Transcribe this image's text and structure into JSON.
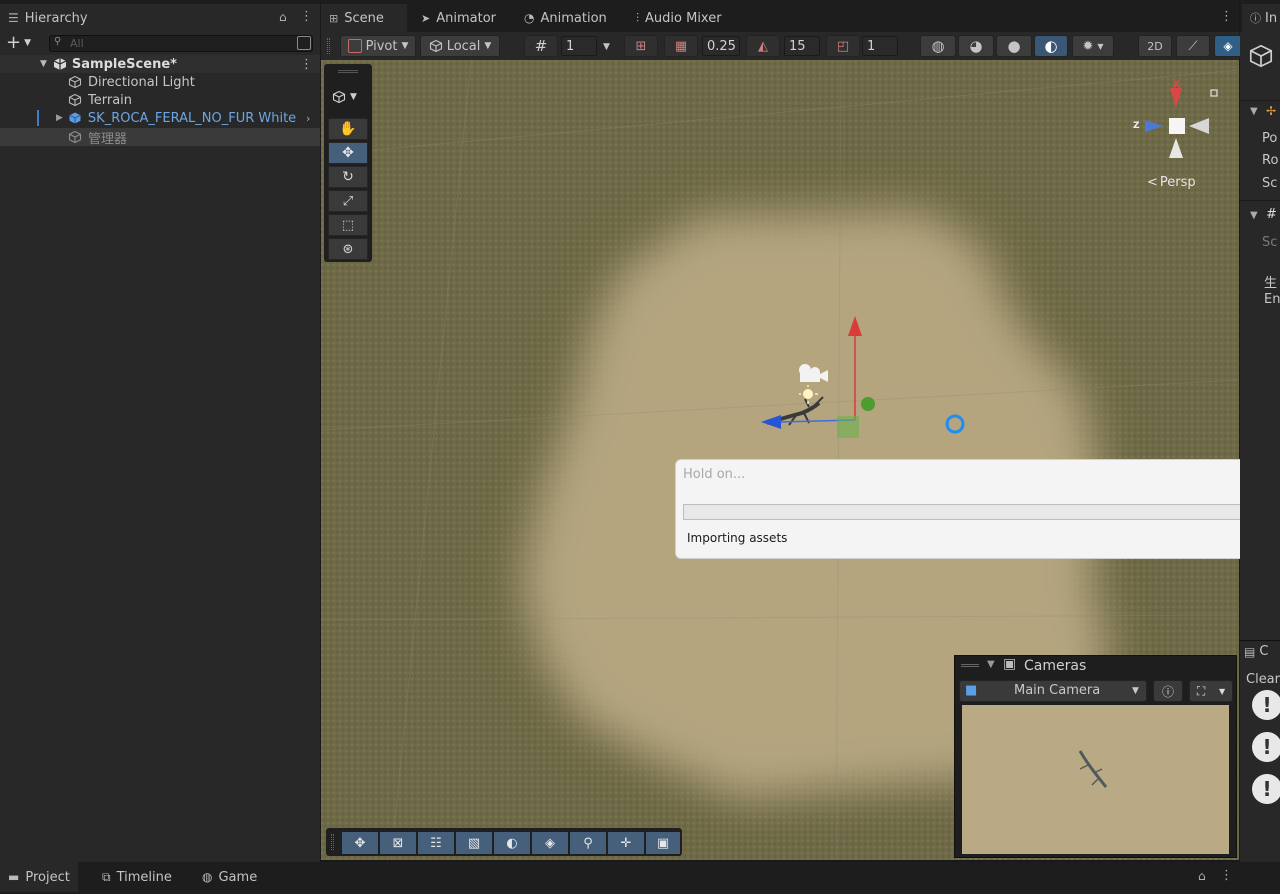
{
  "hierarchy": {
    "tab_label": "Hierarchy",
    "search_placeholder": "All",
    "scene_name": "SampleScene*",
    "items": [
      {
        "label": "Directional Light"
      },
      {
        "label": "Terrain"
      },
      {
        "label": "SK_ROCA_FERAL_NO_FUR White"
      },
      {
        "label": "管理器"
      }
    ]
  },
  "scene_tabs": [
    {
      "label": "Scene"
    },
    {
      "label": "Animator"
    },
    {
      "label": "Animation"
    },
    {
      "label": "Audio Mixer"
    }
  ],
  "toolbar": {
    "pivot_label": "Pivot",
    "local_label": "Local",
    "grid_value": "1",
    "snap_value": "0.25",
    "rotate_snap_value": "15",
    "scale_snap_value": "1"
  },
  "gizmo": {
    "persp_label": "Persp",
    "axis_z": "Z",
    "axis_x": "X"
  },
  "dialog": {
    "title": "Hold on...",
    "progress": 0,
    "message": "Importing assets"
  },
  "cameras": {
    "title": "Cameras",
    "selected_camera": "Main Camera"
  },
  "right_panel": {
    "tab_label": "In",
    "row_labels": [
      "Po",
      "Ro",
      "Sc",
      "Sc",
      "生",
      "En"
    ],
    "bottom_tab": "C",
    "clear_label": "Clear"
  },
  "bottom_tabs": [
    {
      "label": "Project"
    },
    {
      "label": "Timeline"
    },
    {
      "label": "Game"
    }
  ],
  "colors": {
    "accent_blue": "#2c5d87",
    "terrain_grass": "#6f6a47",
    "terrain_sand": "#b3a47e",
    "selected_prefab_text": "#6ea6e3"
  }
}
